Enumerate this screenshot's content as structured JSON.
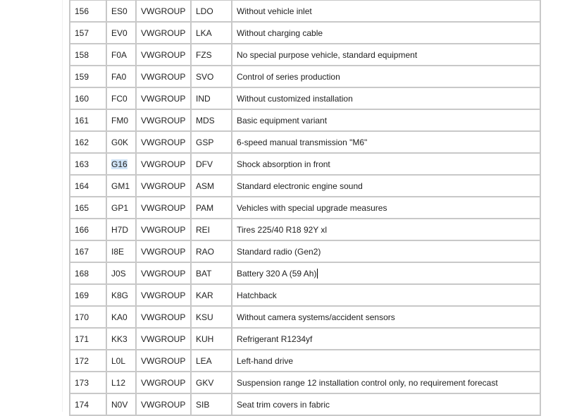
{
  "table": {
    "rows": [
      {
        "num": "156",
        "code": "ES0",
        "family": "VWGROUP",
        "group": "LDO",
        "description": "Without vehicle inlet"
      },
      {
        "num": "157",
        "code": "EV0",
        "family": "VWGROUP",
        "group": "LKA",
        "description": "Without charging cable"
      },
      {
        "num": "158",
        "code": "F0A",
        "family": "VWGROUP",
        "group": "FZS",
        "description": "No special purpose vehicle, standard equipment"
      },
      {
        "num": "159",
        "code": "FA0",
        "family": "VWGROUP",
        "group": "SVO",
        "description": "Control of series production"
      },
      {
        "num": "160",
        "code": "FC0",
        "family": "VWGROUP",
        "group": "IND",
        "description": "Without customized installation"
      },
      {
        "num": "161",
        "code": "FM0",
        "family": "VWGROUP",
        "group": "MDS",
        "description": "Basic equipment variant"
      },
      {
        "num": "162",
        "code": "G0K",
        "family": "VWGROUP",
        "group": "GSP",
        "description": "6-speed manual transmission \"M6\""
      },
      {
        "num": "163",
        "code": "G16",
        "family": "VWGROUP",
        "group": "DFV",
        "description": "Shock absorption in front"
      },
      {
        "num": "164",
        "code": "GM1",
        "family": "VWGROUP",
        "group": "ASM",
        "description": "Standard electronic engine sound"
      },
      {
        "num": "165",
        "code": "GP1",
        "family": "VWGROUP",
        "group": "PAM",
        "description": "Vehicles with special upgrade measures"
      },
      {
        "num": "166",
        "code": "H7D",
        "family": "VWGROUP",
        "group": "REI",
        "description": "Tires 225/40 R18 92Y xl"
      },
      {
        "num": "167",
        "code": "I8E",
        "family": "VWGROUP",
        "group": "RAO",
        "description": "Standard radio (Gen2)"
      },
      {
        "num": "168",
        "code": "J0S",
        "family": "VWGROUP",
        "group": "BAT",
        "description": "Battery 320 A (59 Ah)"
      },
      {
        "num": "169",
        "code": "K8G",
        "family": "VWGROUP",
        "group": "KAR",
        "description": "Hatchback"
      },
      {
        "num": "170",
        "code": "KA0",
        "family": "VWGROUP",
        "group": "KSU",
        "description": "Without camera systems/accident sensors"
      },
      {
        "num": "171",
        "code": "KK3",
        "family": "VWGROUP",
        "group": "KUH",
        "description": "Refrigerant R1234yf"
      },
      {
        "num": "172",
        "code": "L0L",
        "family": "VWGROUP",
        "group": "LEA",
        "description": "Left-hand drive"
      },
      {
        "num": "173",
        "code": "L12",
        "family": "VWGROUP",
        "group": "GKV",
        "description": "Suspension range 12 installation control only, no requirement forecast"
      },
      {
        "num": "174",
        "code": "N0V",
        "family": "VWGROUP",
        "group": "SIB",
        "description": "Seat trim covers in fabric"
      }
    ],
    "selected_code_row": 7,
    "caret_row": 12
  },
  "colors": {
    "border": "#c8c8c8",
    "selection": "#cfe3f7",
    "text": "#222222"
  }
}
